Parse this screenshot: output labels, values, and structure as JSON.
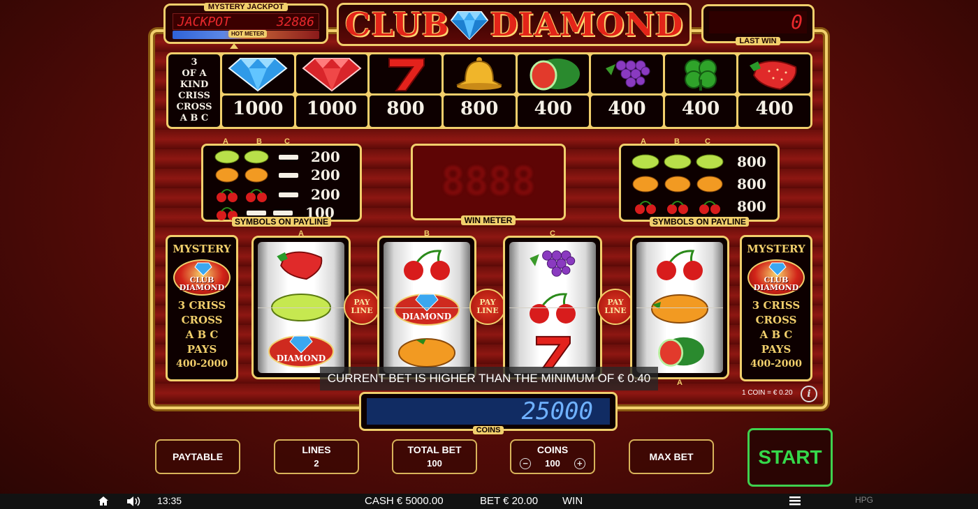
{
  "header": {
    "jackpot_title": "MYSTERY JACKPOT",
    "jackpot_label": "JACKPOT",
    "jackpot_value": "32886",
    "hot_meter": "HOT METER",
    "logo_word1": "CLUB",
    "logo_word2": "DIAMOND",
    "last_win_value": "0",
    "last_win_label": "LAST WIN"
  },
  "paytable": {
    "rule": [
      "3",
      "OF A",
      "KIND",
      "CRISS",
      "CROSS",
      "A B C"
    ],
    "items": [
      {
        "icon": "blue-diamond-icon",
        "value": "1000"
      },
      {
        "icon": "red-diamond-icon",
        "value": "1000"
      },
      {
        "icon": "seven-icon",
        "value": "800"
      },
      {
        "icon": "bell-icon",
        "value": "800"
      },
      {
        "icon": "watermelon-icon",
        "value": "400"
      },
      {
        "icon": "grapes-icon",
        "value": "400"
      },
      {
        "icon": "clover-icon",
        "value": "400"
      },
      {
        "icon": "strawberry-icon",
        "value": "400"
      }
    ]
  },
  "left_small": {
    "abc": [
      "A",
      "B",
      "C"
    ],
    "rows": [
      "200",
      "200",
      "200",
      "100"
    ],
    "footer": "SYMBOLS ON PAYLINE"
  },
  "right_small": {
    "abc": [
      "A",
      "B",
      "C"
    ],
    "rows": [
      "800",
      "800",
      "800"
    ],
    "footer": "SYMBOLS ON PAYLINE"
  },
  "win_meter": {
    "label": "WIN METER"
  },
  "mystery": {
    "title": "MYSTERY",
    "badge1": "CLUB",
    "badge2": "DIAMOND",
    "lines": [
      "3 CRISS",
      "CROSS",
      "A B C",
      "PAYS"
    ],
    "range": "400-2000"
  },
  "reels": {
    "labels": [
      "A",
      "B",
      "C",
      "A"
    ],
    "payline_label1": "PAY",
    "payline_label2": "LINE"
  },
  "message": "CURRENT BET IS HIGHER THAN THE MINIMUM OF € 0.40",
  "coin_value": "1 COIN = € 0.20",
  "coins": {
    "value": "25000",
    "label": "COINS"
  },
  "buttons": {
    "paytable": "PAYTABLE",
    "lines_label": "LINES",
    "lines_value": "2",
    "total_bet_label": "TOTAL BET",
    "total_bet_value": "100",
    "coins_label": "COINS",
    "coins_value": "100",
    "minus": "−",
    "plus": "+",
    "max_bet": "MAX BET",
    "start": "START"
  },
  "statusbar": {
    "time": "13:35",
    "cash": "CASH € 5000.00",
    "bet": "BET € 20.00",
    "win": "WIN",
    "brand": "HPG"
  },
  "colors": {
    "gold": "#f1cf6c",
    "red": "#e32419",
    "green": "#35d84a"
  }
}
